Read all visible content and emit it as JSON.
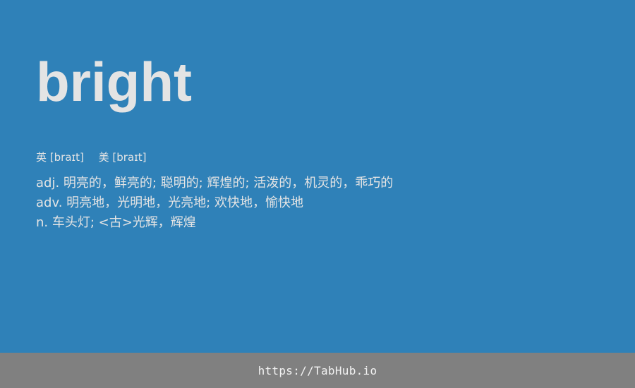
{
  "entry": {
    "word": "bright",
    "phonetics": [
      {
        "region": "英",
        "ipa": "[braɪt]"
      },
      {
        "region": "美",
        "ipa": "[braɪt]"
      }
    ],
    "definitions": [
      "adj. 明亮的，鲜亮的; 聪明的; 辉煌的; 活泼的，机灵的，乖巧的",
      "adv. 明亮地，光明地，光亮地; 欢快地，愉快地",
      "n. 车头灯; <古>光辉，辉煌"
    ]
  },
  "footer": {
    "link_text": "https://TabHub.io"
  },
  "colors": {
    "background": "#2f81b8",
    "text": "#e4e4e4",
    "footer_background": "#808080",
    "footer_text": "#f2f2f2"
  }
}
